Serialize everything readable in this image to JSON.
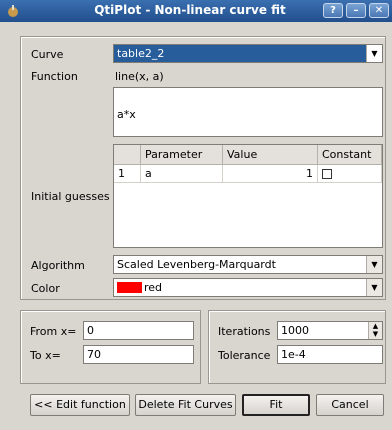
{
  "window": {
    "title": "QtiPlot - Non-linear curve fit",
    "help_label": "?",
    "minimize_label": "–",
    "close_label": "✕"
  },
  "fit": {
    "curve_label": "Curve",
    "curve_value": "table2_2",
    "function_label": "Function",
    "function_value": "line(x, a)",
    "formula": "a*x",
    "initial_guesses_label": "Initial guesses",
    "table": {
      "columns": [
        "",
        "Parameter",
        "Value",
        "Constant"
      ],
      "rows": [
        {
          "index": "1",
          "parameter": "a",
          "value": "1",
          "constant": false
        }
      ]
    },
    "algorithm_label": "Algorithm",
    "algorithm_value": "Scaled Levenberg-Marquardt",
    "color_label": "Color",
    "color_value": "red",
    "color_swatch": "#ff0000"
  },
  "range": {
    "from_label": "From x=",
    "from_value": "0",
    "to_label": "To x=",
    "to_value": "70"
  },
  "settings": {
    "iterations_label": "Iterations",
    "iterations_value": "1000",
    "tolerance_label": "Tolerance",
    "tolerance_value": "1e-4"
  },
  "buttons": {
    "edit_function": "<< Edit function",
    "delete_fit_curves": "Delete Fit Curves",
    "fit": "Fit",
    "cancel": "Cancel"
  },
  "colors": {
    "selection": "#275d9b",
    "titlebar": "#2f60a0"
  }
}
